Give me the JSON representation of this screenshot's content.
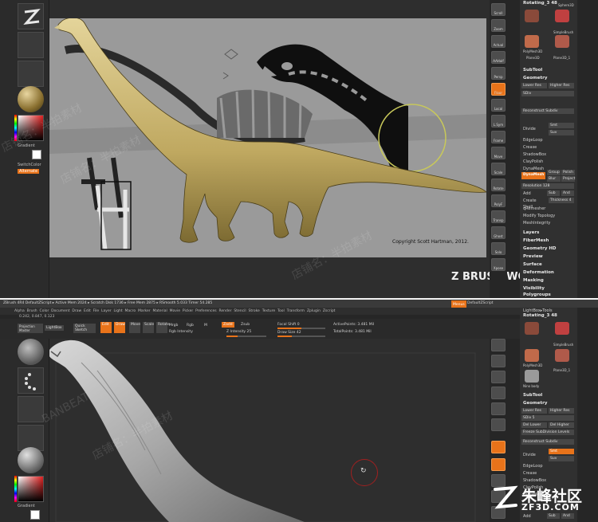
{
  "top": {
    "shelf": {
      "gradient_label": "Gradient",
      "switch_color_label": "SwitchColor",
      "alternate_label": "Alternate"
    },
    "copyright": "Copyright Scott Hartman, 2012.",
    "brand_watermark": "Z BRUSH WORKSHOPS",
    "shop_watermarks": [
      "店铺名：半拍素材",
      "店铺名：半拍素材",
      "店铺名：半拍素材"
    ],
    "right_icons": [
      "Scroll",
      "Zoom",
      "Actual",
      "AAHalf",
      "Persp",
      "Floor",
      "Local",
      "L.Sym",
      "Frame",
      "Move",
      "Scale",
      "Rotate",
      "PolyF",
      "Transp",
      "Ghost",
      "Solo",
      "Xpose"
    ],
    "palette": {
      "header": "Rotating_3 48",
      "thumbs": [
        "Sphere3D",
        "SimpleBrush",
        "PolyMesh3D",
        "Plane3D_1",
        "Plane3D"
      ],
      "subtool": "SubTool",
      "geometry": "Geometry",
      "lower_res": "Lower Res",
      "higher_res": "Higher Res",
      "sdiv": "SDiv",
      "reconstruct": "Reconstruct Subdiv",
      "divide": "Divide",
      "smt": "Smt",
      "suv": "Suv",
      "edge_loop": "EdgeLoop",
      "crease": "Crease",
      "shadow_box": "ShadowBox",
      "clay_polish": "ClayPolish",
      "dynamesh_header": "DynaMesh",
      "dynamesh_button": "DynaMesh",
      "group": "Group",
      "polish": "Polish",
      "blur": "Blur",
      "project": "Project",
      "resolution": "Resolution 128",
      "add": "Add",
      "sub": "Sub",
      "and": "And",
      "create_shell": "Create Shell",
      "thickness": "Thickness 4",
      "qremesher": "qRemesher",
      "modify_topology": "Modify Topology",
      "mesh_integrity": "MeshIntegrity",
      "layers": "Layers",
      "fibermesh": "FiberMesh",
      "geometry_hd": "Geometry HD",
      "preview": "Preview",
      "surface": "Surface",
      "deformation": "Deformation",
      "masking": "Masking",
      "visibility": "Visibility",
      "polygroups": "Polygroups"
    }
  },
  "bottom": {
    "title_bar": "ZBrush 4R4   DefaultZScript   ▸ Active Mem 2024 ▸ Scratch Disk 1736 ▸ Free Mem 2875 ▸ RSmooth 5.033 Timer 54.285",
    "menu": [
      "Alpha",
      "Brush",
      "Color",
      "Document",
      "Draw",
      "Edit",
      "File",
      "Layer",
      "Light",
      "Macro",
      "Marker",
      "Material",
      "Movie",
      "Picker",
      "Preferences",
      "Render",
      "Stencil",
      "Stroke",
      "Texture",
      "Tool",
      "Transform",
      "Zplugin",
      "Zscript"
    ],
    "menu_right_menus": "Menus",
    "menu_right_script": "DefaultZScript",
    "coords": "0.242, 0.847, 0.123",
    "toolbar": {
      "projection_master": "Projection Master",
      "lightbox": "LightBox",
      "quick_sketch": "Quick Sketch",
      "edit": "Edit",
      "draw": "Draw",
      "move": "Move",
      "scale": "Scale",
      "rotate": "Rotate",
      "mrgb": "Mrgb",
      "rgb": "Rgb",
      "m": "M",
      "zadd": "Zadd",
      "zsub": "Zsub",
      "z_intensity": "Z Intensity 25",
      "rgb_intensity": "Rgb Intensity",
      "focal_shift": "Focal Shift 0",
      "draw_size": "Draw Size 42",
      "active_points": "ActivePoints: 3.481 Mil",
      "total_points": "TotalPoints: 3.481 Mil"
    },
    "palette": {
      "header": "Rotating_3 48",
      "lightbox_tools": "LightBox▸Tools",
      "thumbs": [
        "Sphere3D",
        "SimpleBrush",
        "PolyMesh3D",
        "Plane3D_1",
        "Nino body"
      ],
      "subtool": "SubTool",
      "geometry": "Geometry",
      "lower_res": "Lower Res",
      "higher_res": "Higher Res",
      "sdiv": "SDiv 5",
      "del_lower": "Del Lower",
      "del_higher": "Del Higher",
      "freeze": "Freeze SubDivision Levels",
      "reconstruct": "Reconstruct Subdiv",
      "divide": "Divide",
      "smt": "Smt",
      "suv": "Suv",
      "edge_loop": "EdgeLoop",
      "crease": "Crease",
      "shadow_box": "ShadowBox",
      "clay_polish": "ClayPolish",
      "dynamesh": "DynaMesh",
      "add": "Add",
      "sub": "Sub",
      "and": "And"
    },
    "shop_watermarks": [
      "BANBEAT",
      "店铺名：半拍素材"
    ],
    "logo_cn": "朱峰社区",
    "logo_en": "ZF3D.COM"
  }
}
